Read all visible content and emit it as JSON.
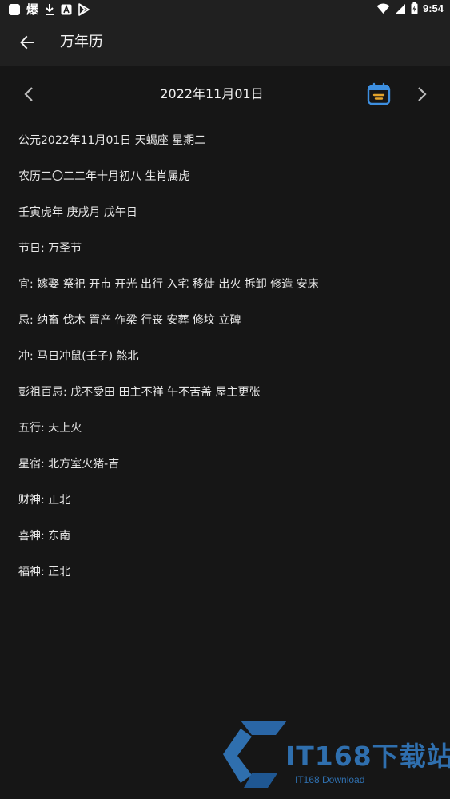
{
  "status_bar": {
    "time": "9:54",
    "left_icons": [
      "app-square-icon",
      "app-bao-icon",
      "download-icon",
      "a-badge-icon",
      "play-store-icon"
    ],
    "right_icons": [
      "wifi-icon",
      "signal-icon",
      "battery-icon"
    ],
    "app_glyph": "爆"
  },
  "header": {
    "title": "万年历"
  },
  "date_nav": {
    "date": "2022年11月01日"
  },
  "info": [
    "公元2022年11月01日 天蝎座 星期二",
    "农历二〇二二年十月初八 生肖属虎",
    "壬寅虎年 庚戌月 戊午日",
    "节日: 万圣节",
    "宜: 嫁娶 祭祀 开市 开光 出行 入宅 移徙 出火 拆卸 修造 安床",
    "忌: 纳畜 伐木 置产 作梁 行丧 安葬 修坟 立碑",
    "冲: 马日冲鼠(壬子) 煞北",
    "彭祖百忌: 戊不受田 田主不祥 午不苦盖 屋主更张",
    "五行: 天上火",
    "星宿: 北方室火猪-吉",
    "财神: 正北",
    "喜神: 东南",
    "福神: 正北"
  ],
  "watermark": {
    "text": "IT168下载站",
    "sub": "IT168 Download"
  },
  "colors": {
    "background": "#161616",
    "app_bar": "#202020",
    "accent_icon": "#3d8fe0",
    "accent_line": "#e3a32b"
  }
}
